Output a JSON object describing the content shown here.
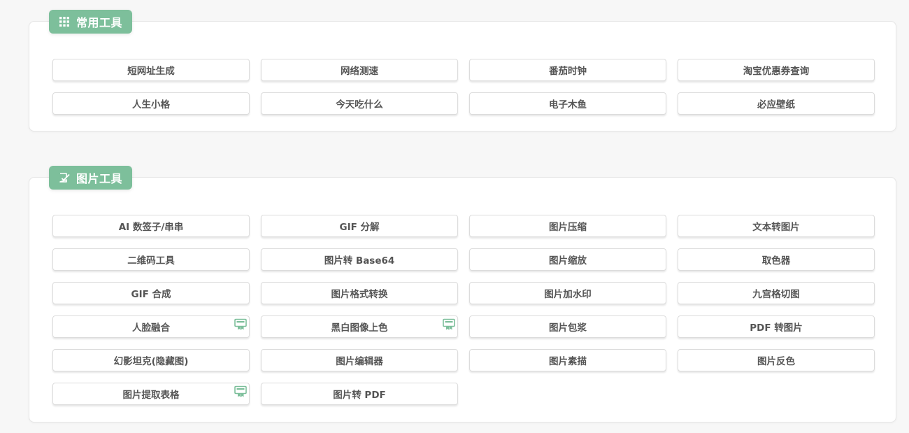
{
  "colors": {
    "accent": "#7dbf9b",
    "button_text": "#555555",
    "page_bg": "#f7f7f7",
    "card_bg": "#ffffff"
  },
  "sections": [
    {
      "title": "常用工具",
      "icon": "grid-icon",
      "items": [
        {
          "label": "短网址生成",
          "badge": false
        },
        {
          "label": "网络测速",
          "badge": false
        },
        {
          "label": "番茄时钟",
          "badge": false
        },
        {
          "label": "淘宝优惠券查询",
          "badge": false
        },
        {
          "label": "人生小格",
          "badge": false
        },
        {
          "label": "今天吃什么",
          "badge": false
        },
        {
          "label": "电子木鱼",
          "badge": false
        },
        {
          "label": "必应壁纸",
          "badge": false
        }
      ]
    },
    {
      "title": "图片工具",
      "icon": "image-edit-icon",
      "items": [
        {
          "label": "AI 数签子/串串",
          "badge": false
        },
        {
          "label": "GIF 分解",
          "badge": false
        },
        {
          "label": "图片压缩",
          "badge": false
        },
        {
          "label": "文本转图片",
          "badge": false
        },
        {
          "label": "二维码工具",
          "badge": false
        },
        {
          "label": "图片转 Base64",
          "badge": false
        },
        {
          "label": "图片缩放",
          "badge": false
        },
        {
          "label": "取色器",
          "badge": false
        },
        {
          "label": "GIF 合成",
          "badge": false
        },
        {
          "label": "图片格式转换",
          "badge": false
        },
        {
          "label": "图片加水印",
          "badge": false
        },
        {
          "label": "九宫格切图",
          "badge": false
        },
        {
          "label": "人脸融合",
          "badge": true
        },
        {
          "label": "黑白图像上色",
          "badge": true
        },
        {
          "label": "图片包浆",
          "badge": false
        },
        {
          "label": "PDF 转图片",
          "badge": false
        },
        {
          "label": "幻影坦克(隐藏图)",
          "badge": false
        },
        {
          "label": "图片编辑器",
          "badge": false
        },
        {
          "label": "图片素描",
          "badge": false
        },
        {
          "label": "图片反色",
          "badge": false
        },
        {
          "label": "图片提取表格",
          "badge": true
        },
        {
          "label": "图片转 PDF",
          "badge": false
        }
      ]
    }
  ]
}
